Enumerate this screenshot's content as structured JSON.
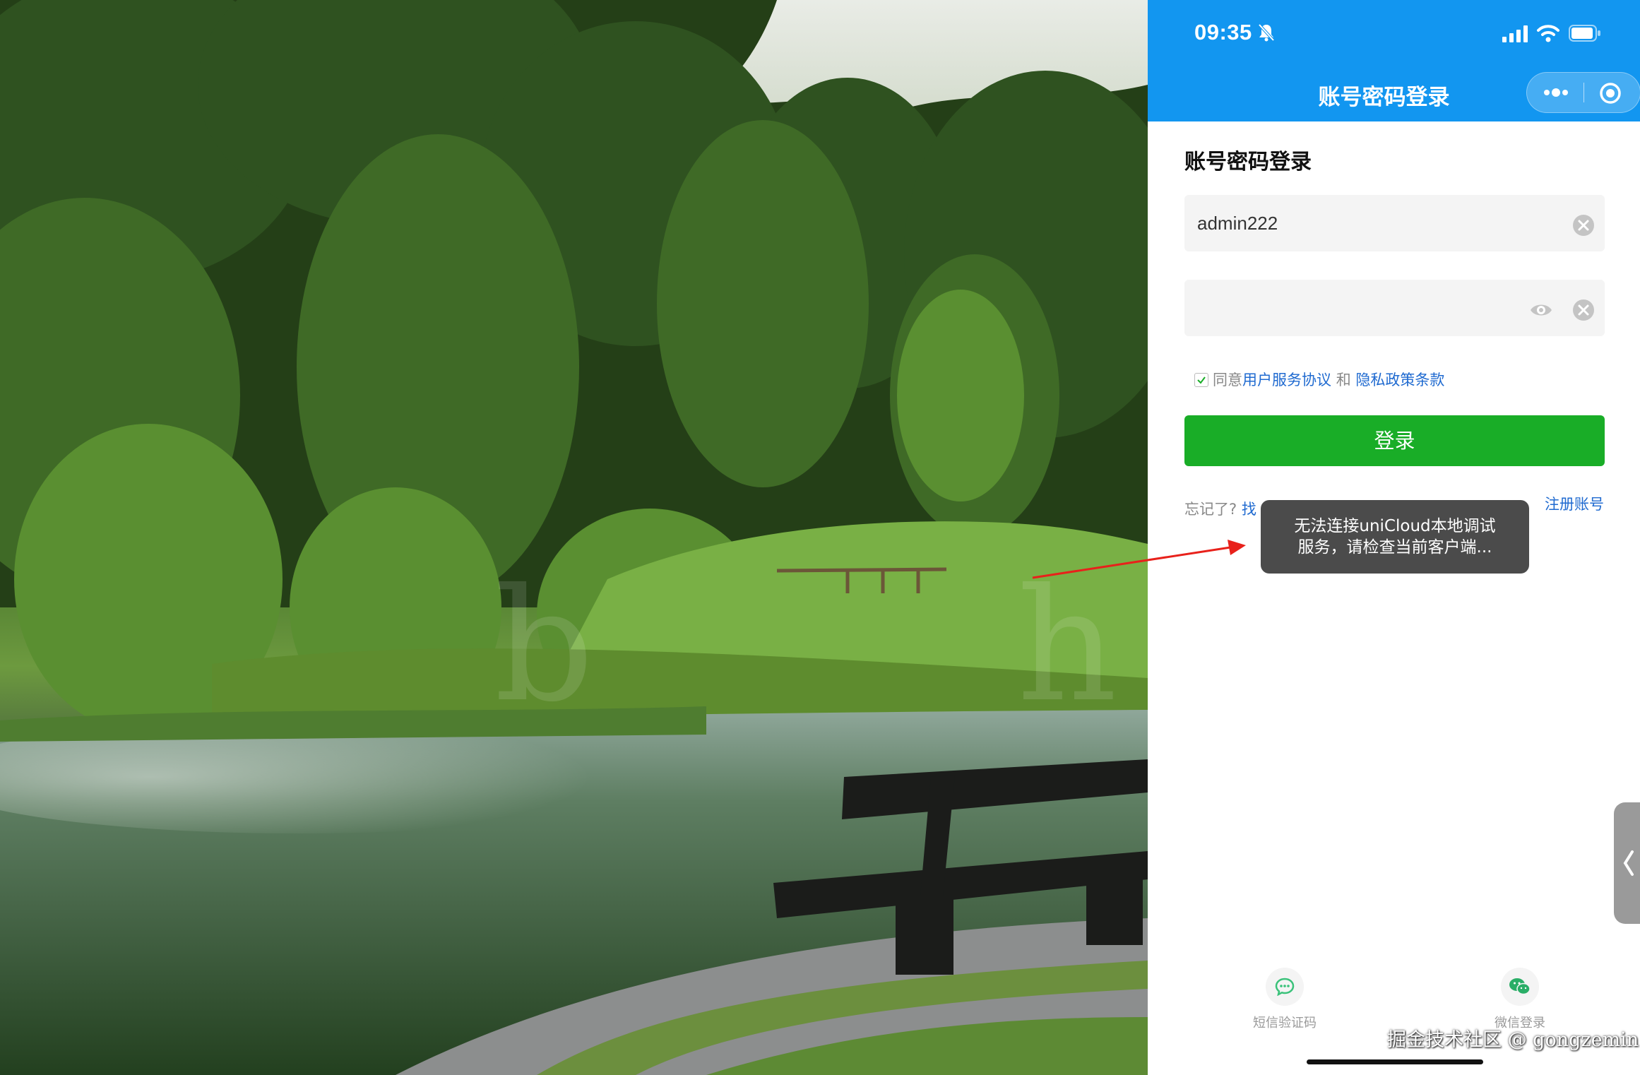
{
  "status_bar": {
    "time": "09:35",
    "icons": [
      "mute-bell-icon",
      "signal-icon",
      "wifi-icon",
      "battery-icon"
    ]
  },
  "nav": {
    "title": "账号密码登录",
    "capsule_icons": [
      "more-dots-icon",
      "target-icon"
    ]
  },
  "form": {
    "heading": "账号密码登录",
    "username_value": "admin222",
    "password_value": "",
    "agreement": {
      "prefix": "同意",
      "terms_link": "用户服务协议",
      "joiner": "和",
      "privacy_link": "隐私政策条款"
    },
    "login_label": "登录",
    "forgot_prefix": "忘记了?",
    "forgot_link_visible": "找",
    "register_label": "注册账号"
  },
  "toast": {
    "line1": "无法连接uniCloud本地调试",
    "line2": "服务，请检查当前客户端..."
  },
  "bottom_options": [
    {
      "label": "短信验证码",
      "icon": "sms-icon"
    },
    {
      "label": "微信登录",
      "icon": "wechat-icon"
    }
  ],
  "side_tab_icon": "chevron-left-icon",
  "watermark": "掘金技术社区 @ gongzemin",
  "colors": {
    "primary_blue": "#1296f0",
    "login_green": "#19ad27",
    "link_blue": "#1f6ad0",
    "annotation_red": "#e8211b"
  }
}
